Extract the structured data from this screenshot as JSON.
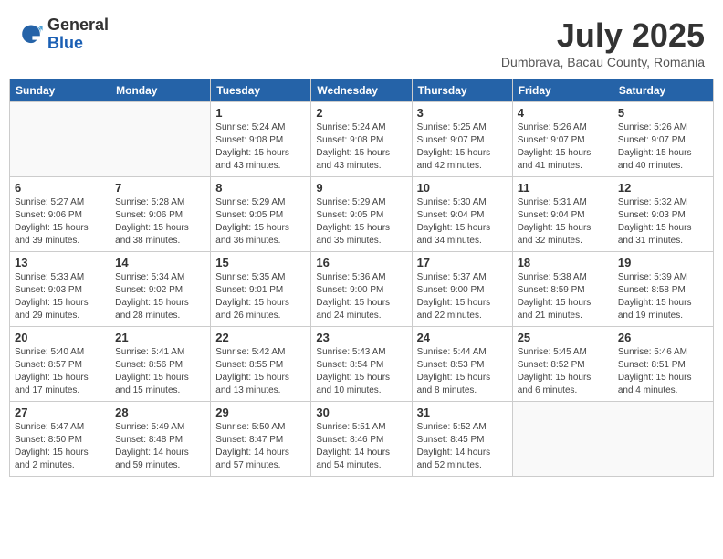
{
  "header": {
    "logo_general": "General",
    "logo_blue": "Blue",
    "title": "July 2025",
    "location": "Dumbrava, Bacau County, Romania"
  },
  "calendar": {
    "days_of_week": [
      "Sunday",
      "Monday",
      "Tuesday",
      "Wednesday",
      "Thursday",
      "Friday",
      "Saturday"
    ],
    "weeks": [
      [
        {
          "day": "",
          "info": ""
        },
        {
          "day": "",
          "info": ""
        },
        {
          "day": "1",
          "info": "Sunrise: 5:24 AM\nSunset: 9:08 PM\nDaylight: 15 hours\nand 43 minutes."
        },
        {
          "day": "2",
          "info": "Sunrise: 5:24 AM\nSunset: 9:08 PM\nDaylight: 15 hours\nand 43 minutes."
        },
        {
          "day": "3",
          "info": "Sunrise: 5:25 AM\nSunset: 9:07 PM\nDaylight: 15 hours\nand 42 minutes."
        },
        {
          "day": "4",
          "info": "Sunrise: 5:26 AM\nSunset: 9:07 PM\nDaylight: 15 hours\nand 41 minutes."
        },
        {
          "day": "5",
          "info": "Sunrise: 5:26 AM\nSunset: 9:07 PM\nDaylight: 15 hours\nand 40 minutes."
        }
      ],
      [
        {
          "day": "6",
          "info": "Sunrise: 5:27 AM\nSunset: 9:06 PM\nDaylight: 15 hours\nand 39 minutes."
        },
        {
          "day": "7",
          "info": "Sunrise: 5:28 AM\nSunset: 9:06 PM\nDaylight: 15 hours\nand 38 minutes."
        },
        {
          "day": "8",
          "info": "Sunrise: 5:29 AM\nSunset: 9:05 PM\nDaylight: 15 hours\nand 36 minutes."
        },
        {
          "day": "9",
          "info": "Sunrise: 5:29 AM\nSunset: 9:05 PM\nDaylight: 15 hours\nand 35 minutes."
        },
        {
          "day": "10",
          "info": "Sunrise: 5:30 AM\nSunset: 9:04 PM\nDaylight: 15 hours\nand 34 minutes."
        },
        {
          "day": "11",
          "info": "Sunrise: 5:31 AM\nSunset: 9:04 PM\nDaylight: 15 hours\nand 32 minutes."
        },
        {
          "day": "12",
          "info": "Sunrise: 5:32 AM\nSunset: 9:03 PM\nDaylight: 15 hours\nand 31 minutes."
        }
      ],
      [
        {
          "day": "13",
          "info": "Sunrise: 5:33 AM\nSunset: 9:03 PM\nDaylight: 15 hours\nand 29 minutes."
        },
        {
          "day": "14",
          "info": "Sunrise: 5:34 AM\nSunset: 9:02 PM\nDaylight: 15 hours\nand 28 minutes."
        },
        {
          "day": "15",
          "info": "Sunrise: 5:35 AM\nSunset: 9:01 PM\nDaylight: 15 hours\nand 26 minutes."
        },
        {
          "day": "16",
          "info": "Sunrise: 5:36 AM\nSunset: 9:00 PM\nDaylight: 15 hours\nand 24 minutes."
        },
        {
          "day": "17",
          "info": "Sunrise: 5:37 AM\nSunset: 9:00 PM\nDaylight: 15 hours\nand 22 minutes."
        },
        {
          "day": "18",
          "info": "Sunrise: 5:38 AM\nSunset: 8:59 PM\nDaylight: 15 hours\nand 21 minutes."
        },
        {
          "day": "19",
          "info": "Sunrise: 5:39 AM\nSunset: 8:58 PM\nDaylight: 15 hours\nand 19 minutes."
        }
      ],
      [
        {
          "day": "20",
          "info": "Sunrise: 5:40 AM\nSunset: 8:57 PM\nDaylight: 15 hours\nand 17 minutes."
        },
        {
          "day": "21",
          "info": "Sunrise: 5:41 AM\nSunset: 8:56 PM\nDaylight: 15 hours\nand 15 minutes."
        },
        {
          "day": "22",
          "info": "Sunrise: 5:42 AM\nSunset: 8:55 PM\nDaylight: 15 hours\nand 13 minutes."
        },
        {
          "day": "23",
          "info": "Sunrise: 5:43 AM\nSunset: 8:54 PM\nDaylight: 15 hours\nand 10 minutes."
        },
        {
          "day": "24",
          "info": "Sunrise: 5:44 AM\nSunset: 8:53 PM\nDaylight: 15 hours\nand 8 minutes."
        },
        {
          "day": "25",
          "info": "Sunrise: 5:45 AM\nSunset: 8:52 PM\nDaylight: 15 hours\nand 6 minutes."
        },
        {
          "day": "26",
          "info": "Sunrise: 5:46 AM\nSunset: 8:51 PM\nDaylight: 15 hours\nand 4 minutes."
        }
      ],
      [
        {
          "day": "27",
          "info": "Sunrise: 5:47 AM\nSunset: 8:50 PM\nDaylight: 15 hours\nand 2 minutes."
        },
        {
          "day": "28",
          "info": "Sunrise: 5:49 AM\nSunset: 8:48 PM\nDaylight: 14 hours\nand 59 minutes."
        },
        {
          "day": "29",
          "info": "Sunrise: 5:50 AM\nSunset: 8:47 PM\nDaylight: 14 hours\nand 57 minutes."
        },
        {
          "day": "30",
          "info": "Sunrise: 5:51 AM\nSunset: 8:46 PM\nDaylight: 14 hours\nand 54 minutes."
        },
        {
          "day": "31",
          "info": "Sunrise: 5:52 AM\nSunset: 8:45 PM\nDaylight: 14 hours\nand 52 minutes."
        },
        {
          "day": "",
          "info": ""
        },
        {
          "day": "",
          "info": ""
        }
      ]
    ]
  }
}
